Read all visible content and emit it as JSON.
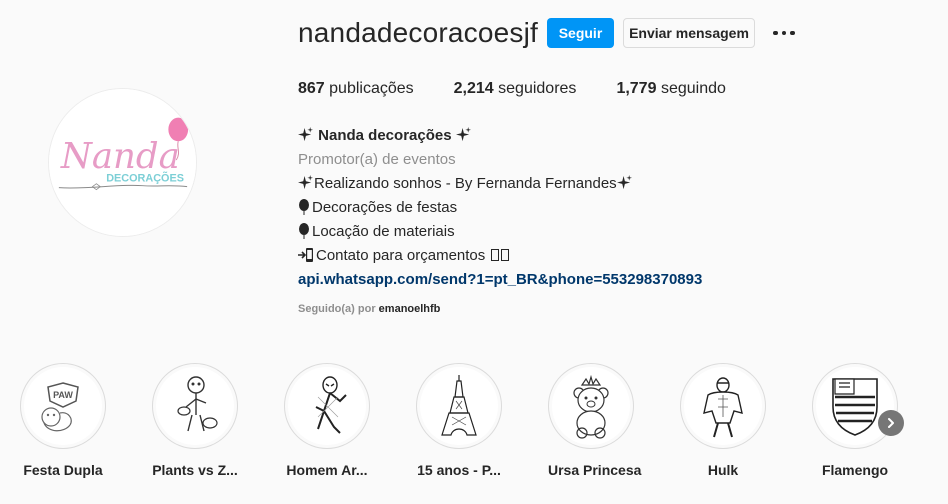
{
  "profile": {
    "username": "nandadecoracoesjf",
    "follow_label": "Seguir",
    "message_label": "Enviar mensagem",
    "more_icon": "more-horizontal-icon"
  },
  "stats": {
    "posts_count": "867",
    "posts_label": "publicações",
    "followers_count": "2,214",
    "followers_label": "seguidores",
    "following_count": "1,779",
    "following_label": "seguindo"
  },
  "avatar": {
    "script_text": "Nanda",
    "sub_text": "DECORAÇÕES"
  },
  "bio": {
    "name": "Nanda decorações",
    "category": "Promotor(a) de eventos",
    "line1": "Realizando sonhos - By Fernanda Fernandes",
    "line2": "Decorações de festas",
    "line3": "Locação de materiais",
    "line4": "Contato para orçamentos",
    "link": "api.whatsapp.com/send?1=pt_BR&phone=553298370893"
  },
  "followed_by": {
    "prefix": "Seguido(a) por",
    "user": "emanoelhfb"
  },
  "highlights": [
    {
      "label": "Festa Dupla",
      "icon": "paw-patrol-icon"
    },
    {
      "label": "Plants vs Z...",
      "icon": "plants-vs-zombies-icon"
    },
    {
      "label": "Homem Ar...",
      "icon": "spiderman-icon"
    },
    {
      "label": "15 anos - P...",
      "icon": "eiffel-tower-icon"
    },
    {
      "label": "Ursa Princesa",
      "icon": "teddy-bear-icon"
    },
    {
      "label": "Hulk",
      "icon": "hulk-icon"
    },
    {
      "label": "Flamengo",
      "icon": "flamengo-shield-icon"
    }
  ],
  "colors": {
    "primary_button": "#0095f6",
    "link": "#00376b",
    "muted": "#8e8e8e",
    "avatar_pink": "#e79cc6",
    "avatar_teal": "#7ccfd6",
    "balloon": "#f07fb3"
  }
}
